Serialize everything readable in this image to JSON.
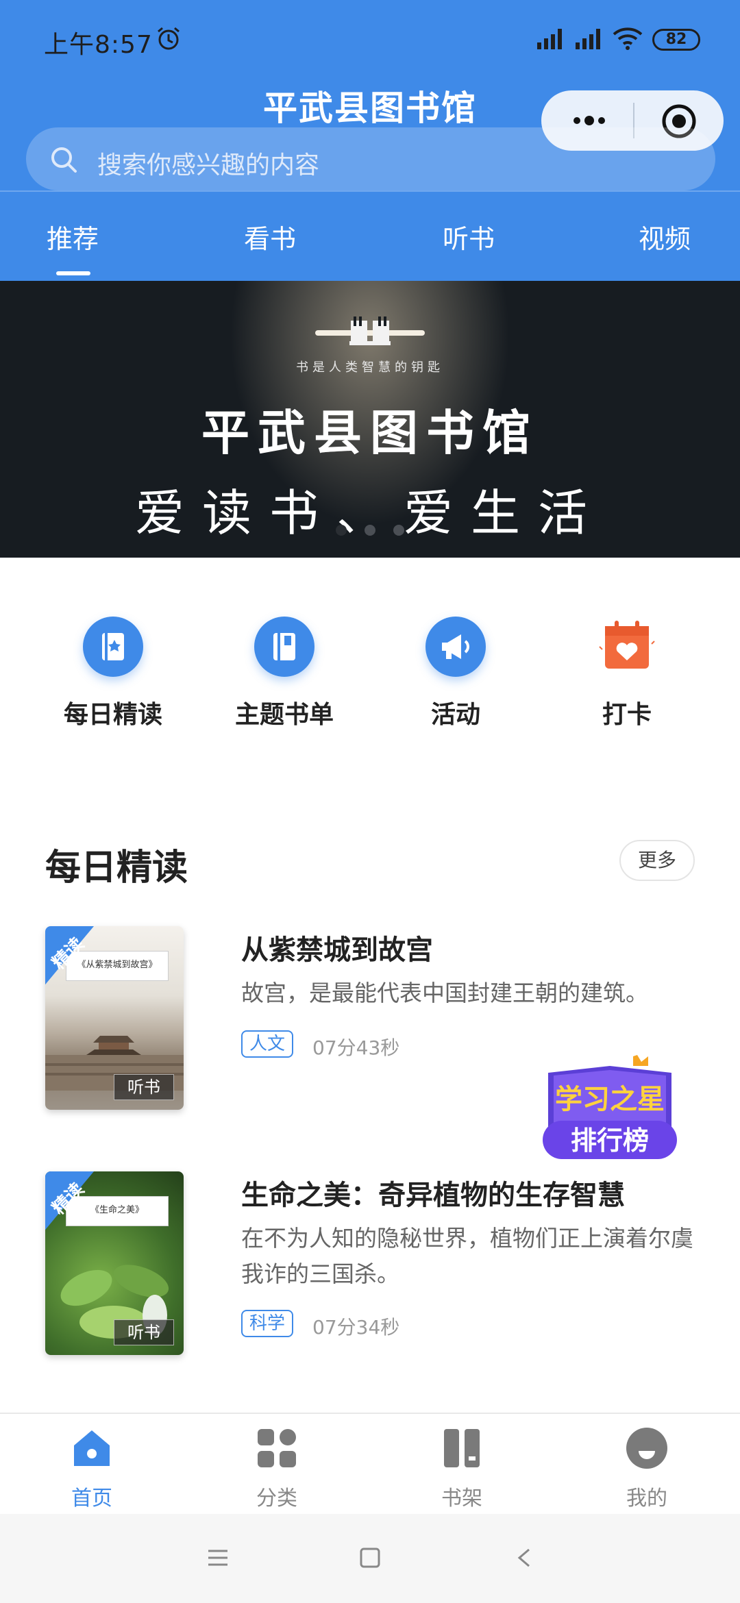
{
  "status": {
    "time": "上午8:57",
    "battery": "82"
  },
  "header": {
    "title": "平武县图书馆",
    "search_placeholder": "搜索你感兴趣的内容"
  },
  "tabs": [
    {
      "label": "推荐",
      "active": true
    },
    {
      "label": "看书"
    },
    {
      "label": "听书"
    },
    {
      "label": "视频"
    }
  ],
  "banner": {
    "slogan": "书是人类智慧的钥匙",
    "title": "平武县图书馆",
    "subtitle": "爱读书、爱生活",
    "active_dot": 0
  },
  "quick_links": [
    {
      "label": "每日精读",
      "icon": "star-book-icon"
    },
    {
      "label": "主题书单",
      "icon": "book-icon"
    },
    {
      "label": "活动",
      "icon": "megaphone-icon"
    },
    {
      "label": "打卡",
      "icon": "calendar-heart-icon"
    }
  ],
  "section": {
    "title": "每日精读",
    "more_label": "更多"
  },
  "items": [
    {
      "ribbon": "精读",
      "cover_title": "《从紫禁城到故宫》",
      "listen": "听书",
      "title": "从紫禁城到故宫",
      "desc": "故宫，是最能代表中国封建王朝的建筑。",
      "category": "人文",
      "duration": "07分43秒"
    },
    {
      "ribbon": "精读",
      "cover_title": "《生命之美》",
      "listen": "听书",
      "title": "生命之美：奇异植物的生存智慧",
      "desc": "在不为人知的隐秘世界，植物们正上演着尔虞我诈的三国杀。",
      "category": "科学",
      "duration": "07分34秒"
    }
  ],
  "floating_badge": {
    "line1": "学习之星",
    "line2": "排行榜"
  },
  "bottom_nav": [
    {
      "label": "首页",
      "icon": "home-icon",
      "active": true
    },
    {
      "label": "分类",
      "icon": "grid-icon"
    },
    {
      "label": "书架",
      "icon": "bookshelf-icon"
    },
    {
      "label": "我的",
      "icon": "profile-icon"
    }
  ],
  "colors": {
    "accent": "#3f8ae8",
    "banner_bg": "#171c21"
  }
}
